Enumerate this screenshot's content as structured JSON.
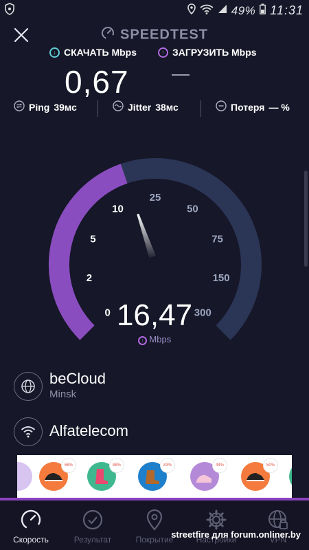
{
  "status_bar": {
    "battery": "49%",
    "time": "11:31"
  },
  "header": {
    "title": "SPEEDTEST"
  },
  "download": {
    "label": "СКАЧАТЬ Mbps",
    "value": "0,67"
  },
  "upload": {
    "label": "ЗАГРУЗИТЬ Mbps",
    "value": "—"
  },
  "metrics": {
    "ping_label": "Ping",
    "ping_value": "39мс",
    "jitter_label": "Jitter",
    "jitter_value": "38мс",
    "loss_label": "Потеря",
    "loss_value": "— %"
  },
  "gauge": {
    "scale": [
      "0",
      "2",
      "5",
      "10",
      "25",
      "50",
      "75",
      "150",
      "300"
    ],
    "current_speed": "16,47",
    "unit": "Mbps",
    "needle_fraction": 0.43,
    "colors": {
      "active": "#8a4dc0",
      "track": "#2b3556",
      "needle": "#ffffff"
    }
  },
  "servers": [
    {
      "name": "beCloud",
      "location": "Minsk",
      "icon": "globe-icon"
    },
    {
      "name": "Alfatelecom",
      "icon": "wifi-icon"
    }
  ],
  "ad": {
    "badges": [
      "68%",
      "88%",
      "83%",
      "44%",
      "50%"
    ]
  },
  "nav": [
    {
      "label": "Скорость",
      "icon": "speedometer-icon",
      "active": true
    },
    {
      "label": "Результат",
      "icon": "check-circle-icon",
      "active": false
    },
    {
      "label": "Покрытие",
      "icon": "map-pin-icon",
      "active": false
    },
    {
      "label": "Настройки",
      "icon": "gear-icon",
      "active": false
    },
    {
      "label": "VPN",
      "icon": "globe-lock-icon",
      "active": false
    }
  ],
  "watermark": "streetfire для forum.onliner.by"
}
